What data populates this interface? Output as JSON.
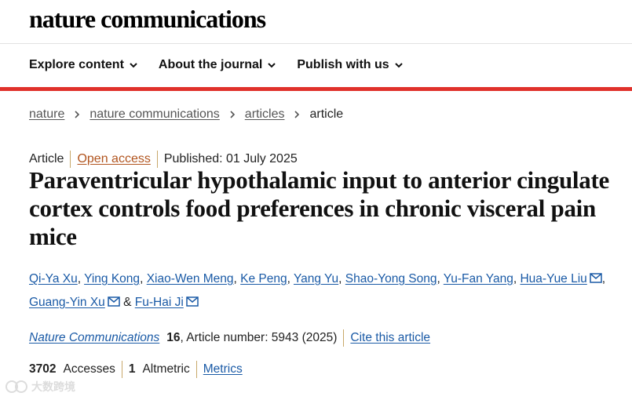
{
  "header": {
    "brand": "nature communications"
  },
  "nav": {
    "items": [
      {
        "label": "Explore content"
      },
      {
        "label": "About the journal"
      },
      {
        "label": "Publish with us"
      }
    ]
  },
  "breadcrumb": {
    "items": [
      {
        "label": "nature"
      },
      {
        "label": "nature communications"
      },
      {
        "label": "articles"
      }
    ],
    "current": "article"
  },
  "article": {
    "type": "Article",
    "access": "Open access",
    "published": "Published: 01 July 2025",
    "title": "Paraventricular hypothalamic input to anterior cingulate cortex controls food preferences in chronic visceral pain mice",
    "authors": [
      {
        "name": "Qi-Ya Xu",
        "email": false,
        "sep": ", "
      },
      {
        "name": "Ying Kong",
        "email": false,
        "sep": ", "
      },
      {
        "name": "Xiao-Wen Meng",
        "email": false,
        "sep": ", "
      },
      {
        "name": "Ke Peng",
        "email": false,
        "sep": ", "
      },
      {
        "name": "Yang Yu",
        "email": false,
        "sep": ", "
      },
      {
        "name": "Shao-Yong Song",
        "email": false,
        "sep": ", "
      },
      {
        "name": "Yu-Fan Yang",
        "email": false,
        "sep": ", "
      },
      {
        "name": "Hua-Yue Liu",
        "email": true,
        "sep": ", "
      },
      {
        "name": "Guang-Yin Xu",
        "email": true,
        "sep": " & "
      },
      {
        "name": "Fu-Hai Ji",
        "email": true,
        "sep": ""
      }
    ],
    "citation": {
      "journal": "Nature Communications",
      "volume": "16",
      "number_text": ", Article number: 5943 (2025)",
      "cite_label": "Cite this article"
    },
    "metrics": {
      "accesses_value": "3702",
      "accesses_label": "Accesses",
      "altmetric_value": "1",
      "altmetric_label": "Altmetric",
      "metrics_link": "Metrics"
    }
  },
  "watermark": {
    "text": "大数跨境"
  },
  "colors": {
    "accent_red": "#e0312b",
    "link_blue": "#1a5aa6",
    "open_access_orange": "#b1541e"
  },
  "icons": {
    "nav_chevron": "chevron-down-icon",
    "breadcrumb_sep": "chevron-right-icon",
    "email": "email-icon"
  }
}
